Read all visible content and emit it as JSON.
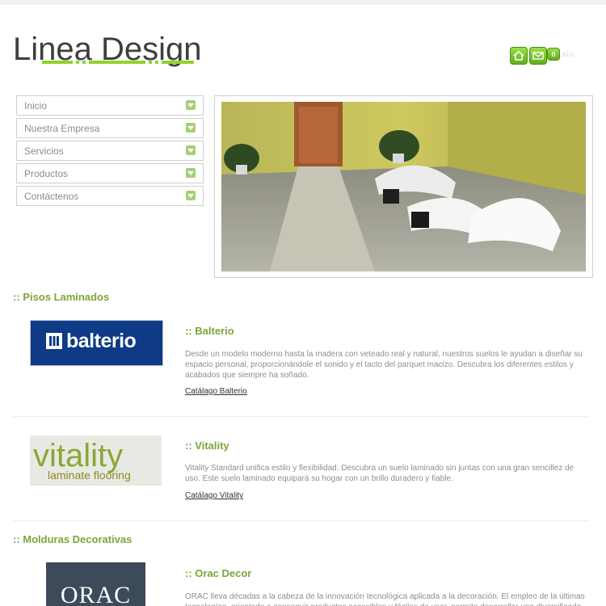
{
  "header": {
    "logo_text": "Linea Design",
    "icons": [
      "home-icon",
      "mail-icon",
      "small-icon"
    ],
    "trail_text": "alu."
  },
  "menu": {
    "items": [
      {
        "label": "Inicio"
      },
      {
        "label": "Nuestra Empresa"
      },
      {
        "label": "Servicios"
      },
      {
        "label": "Productos"
      },
      {
        "label": "Contáctenos"
      }
    ]
  },
  "sections": [
    {
      "title": ":: Pisos Laminados",
      "products": [
        {
          "logo_text": "balterio",
          "title": ":: Balterio",
          "description": "Desde un modelo moderno hasta la madera con veteado real y natural, nuestros suelos le ayudan a diseñar su espacio personal, proporcionándole el sonido y el tacto del parquet macizo. Descubra los diferentes estilos y acabados que siempre ha soñado.",
          "link": "Catálago Balterio"
        },
        {
          "logo_text": "vitality",
          "logo_subtext": "laminate flooring",
          "title": ":: Vitality",
          "description": "Vitality Standard unifica estilo y flexibilidad. Descubra un suelo laminado sin juntas con una gran sencillez de uso. Este suelo laminado equipará su hogar con un brillo duradero y fiable.",
          "link": "Catálago Vitality"
        }
      ]
    },
    {
      "title": ":: Molduras Decorativas",
      "products": [
        {
          "logo_text": "ORAC",
          "title": ":: Orac Decor",
          "description": "ORAC lleva décadas a la cabeza de la innovación tecnológica aplicada a la decoración. El empleo de la últimas tecnologías, orientado a conseguir productos accesibles y fáciles de usar, permite desarrollar una diversificada"
        }
      ]
    }
  ],
  "colors": {
    "accent_green": "#7ea43a",
    "icon_green": "#6cc01f",
    "menu_arrow": "#a7cf76",
    "balterio_blue": "#0e3a86"
  }
}
